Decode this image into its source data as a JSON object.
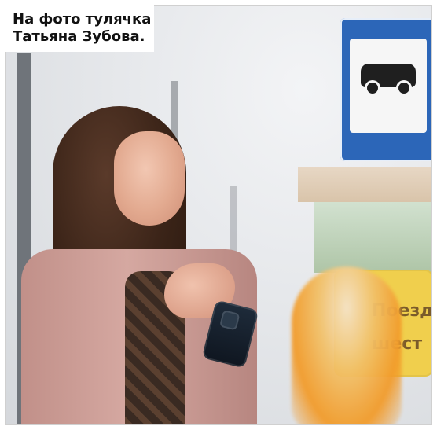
{
  "caption": {
    "line1": "На фото тулячка",
    "line2": "Татьяна Зубова."
  },
  "photo": {
    "kiosk_text_line1": "Поезд",
    "kiosk_text_line2": "шест"
  }
}
